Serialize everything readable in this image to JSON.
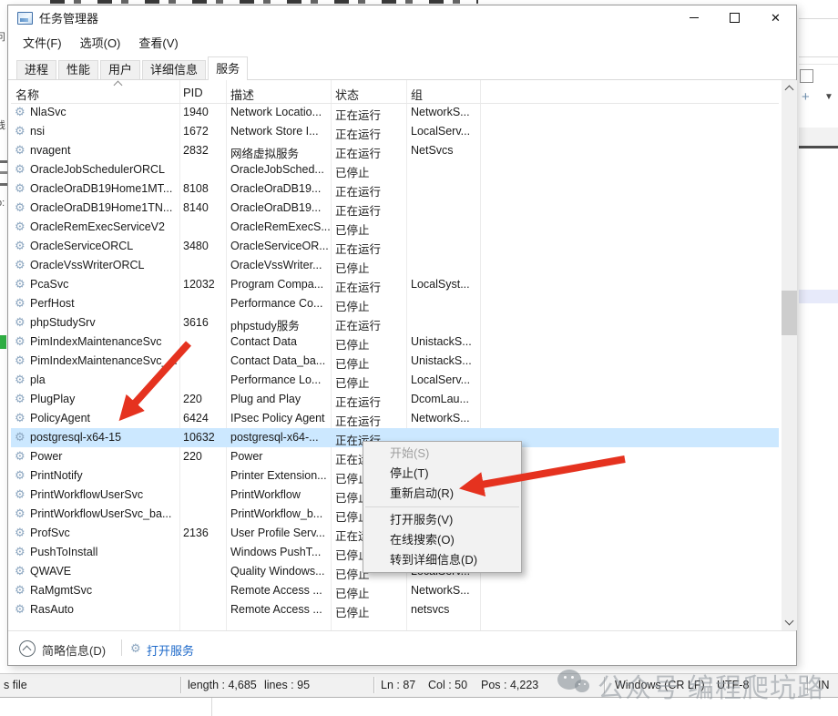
{
  "window": {
    "title": "任务管理器",
    "menus": [
      {
        "name": "menu-file",
        "label": "文件(F)"
      },
      {
        "name": "menu-options",
        "label": "选项(O)"
      },
      {
        "name": "menu-view",
        "label": "查看(V)"
      }
    ],
    "tabs": [
      {
        "name": "tab-processes",
        "label": "进程",
        "active": false
      },
      {
        "name": "tab-performance",
        "label": "性能",
        "active": false
      },
      {
        "name": "tab-users",
        "label": "用户",
        "active": false
      },
      {
        "name": "tab-details",
        "label": "详细信息",
        "active": false
      },
      {
        "name": "tab-services",
        "label": "服务",
        "active": true
      }
    ],
    "columns": [
      {
        "name": "col-name",
        "label": "名称"
      },
      {
        "name": "col-pid",
        "label": "PID"
      },
      {
        "name": "col-description",
        "label": "描述"
      },
      {
        "name": "col-status",
        "label": "状态"
      },
      {
        "name": "col-group",
        "label": "组"
      }
    ],
    "rows": [
      {
        "name": "NlaSvc",
        "pid": "1940",
        "desc": "Network Locatio...",
        "status": "正在运行",
        "group": "NetworkS...",
        "selected": false
      },
      {
        "name": "nsi",
        "pid": "1672",
        "desc": "Network Store I...",
        "status": "正在运行",
        "group": "LocalServ...",
        "selected": false
      },
      {
        "name": "nvagent",
        "pid": "2832",
        "desc": "网络虚拟服务",
        "status": "正在运行",
        "group": "NetSvcs",
        "selected": false
      },
      {
        "name": "OracleJobSchedulerORCL",
        "pid": "",
        "desc": "OracleJobSched...",
        "status": "已停止",
        "group": "",
        "selected": false
      },
      {
        "name": "OracleOraDB19Home1MT...",
        "pid": "8108",
        "desc": "OracleOraDB19...",
        "status": "正在运行",
        "group": "",
        "selected": false
      },
      {
        "name": "OracleOraDB19Home1TN...",
        "pid": "8140",
        "desc": "OracleOraDB19...",
        "status": "正在运行",
        "group": "",
        "selected": false
      },
      {
        "name": "OracleRemExecServiceV2",
        "pid": "",
        "desc": "OracleRemExecS...",
        "status": "已停止",
        "group": "",
        "selected": false
      },
      {
        "name": "OracleServiceORCL",
        "pid": "3480",
        "desc": "OracleServiceOR...",
        "status": "正在运行",
        "group": "",
        "selected": false
      },
      {
        "name": "OracleVssWriterORCL",
        "pid": "",
        "desc": "OracleVssWriter...",
        "status": "已停止",
        "group": "",
        "selected": false
      },
      {
        "name": "PcaSvc",
        "pid": "12032",
        "desc": "Program Compa...",
        "status": "正在运行",
        "group": "LocalSyst...",
        "selected": false
      },
      {
        "name": "PerfHost",
        "pid": "",
        "desc": "Performance Co...",
        "status": "已停止",
        "group": "",
        "selected": false
      },
      {
        "name": "phpStudySrv",
        "pid": "3616",
        "desc": "phpstudy服务",
        "status": "正在运行",
        "group": "",
        "selected": false
      },
      {
        "name": "PimIndexMaintenanceSvc",
        "pid": "",
        "desc": "Contact Data",
        "status": "已停止",
        "group": "UnistackS...",
        "selected": false
      },
      {
        "name": "PimIndexMaintenanceSvc_...",
        "pid": "",
        "desc": "Contact Data_ba...",
        "status": "已停止",
        "group": "UnistackS...",
        "selected": false
      },
      {
        "name": "pla",
        "pid": "",
        "desc": "Performance Lo...",
        "status": "已停止",
        "group": "LocalServ...",
        "selected": false
      },
      {
        "name": "PlugPlay",
        "pid": "220",
        "desc": "Plug and Play",
        "status": "正在运行",
        "group": "DcomLau...",
        "selected": false
      },
      {
        "name": "PolicyAgent",
        "pid": "6424",
        "desc": "IPsec Policy Agent",
        "status": "正在运行",
        "group": "NetworkS...",
        "selected": false
      },
      {
        "name": "postgresql-x64-15",
        "pid": "10632",
        "desc": "postgresql-x64-...",
        "status": "正在运行",
        "group": "",
        "selected": true
      },
      {
        "name": "Power",
        "pid": "220",
        "desc": "Power",
        "status": "正在运行",
        "group": "",
        "selected": false
      },
      {
        "name": "PrintNotify",
        "pid": "",
        "desc": "Printer Extension...",
        "status": "已停止",
        "group": "",
        "selected": false
      },
      {
        "name": "PrintWorkflowUserSvc",
        "pid": "",
        "desc": "PrintWorkflow",
        "status": "已停止",
        "group": "",
        "selected": false
      },
      {
        "name": "PrintWorkflowUserSvc_ba...",
        "pid": "",
        "desc": "PrintWorkflow_b...",
        "status": "已停止",
        "group": "",
        "selected": false
      },
      {
        "name": "ProfSvc",
        "pid": "2136",
        "desc": "User Profile Serv...",
        "status": "正在运行",
        "group": "",
        "selected": false
      },
      {
        "name": "PushToInstall",
        "pid": "",
        "desc": "Windows PushT...",
        "status": "已停止",
        "group": "",
        "selected": false
      },
      {
        "name": "QWAVE",
        "pid": "",
        "desc": "Quality Windows...",
        "status": "已停止",
        "group": "LocalServ...",
        "selected": false
      },
      {
        "name": "RaMgmtSvc",
        "pid": "",
        "desc": "Remote Access ...",
        "status": "已停止",
        "group": "NetworkS...",
        "selected": false
      },
      {
        "name": "RasAuto",
        "pid": "",
        "desc": "Remote Access ...",
        "status": "已停止",
        "group": "netsvcs",
        "selected": false
      }
    ],
    "footer": {
      "toggle_label": "简略信息(D)",
      "open_services_label": "打开服务"
    }
  },
  "context_menu": {
    "items": [
      {
        "name": "menu-start",
        "label": "开始(S)",
        "disabled": true
      },
      {
        "name": "menu-stop",
        "label": "停止(T)"
      },
      {
        "name": "menu-restart",
        "label": "重新启动(R)"
      },
      {
        "separator": true
      },
      {
        "name": "menu-open-services",
        "label": "打开服务(V)"
      },
      {
        "name": "menu-search-online",
        "label": "在线搜索(O)"
      },
      {
        "name": "menu-go-to-details",
        "label": "转到详细信息(D)"
      }
    ]
  },
  "statusbar": {
    "file_type": "s file",
    "length": "length : 4,685",
    "lines": "lines : 95",
    "ln": "Ln : 87",
    "col": "Col : 50",
    "pos": "Pos : 4,223",
    "eol": "Windows (CR LF)",
    "encoding": "UTF-8",
    "ins": "IN"
  },
  "watermark": {
    "label": "公众号 编程爬坑路"
  },
  "colors": {
    "selection": "#cce8ff",
    "arrow": "#e5321f",
    "link": "#1c68c9",
    "disabled": "#9f9f9f"
  }
}
